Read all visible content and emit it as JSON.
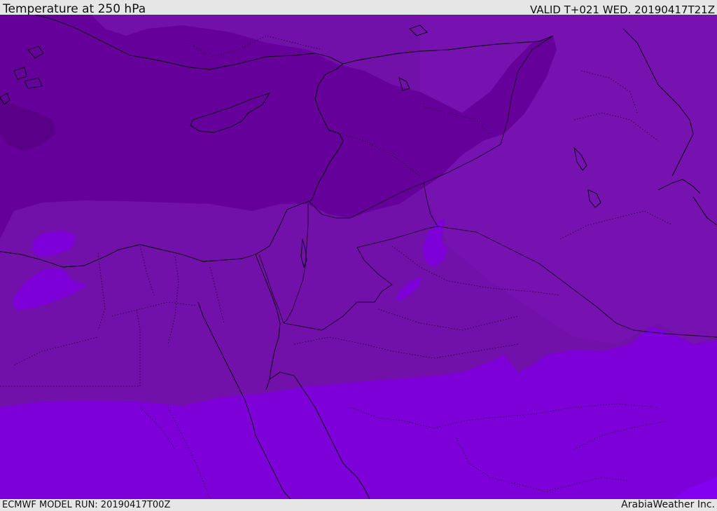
{
  "header": {
    "title": "Temperature at 250 hPa",
    "valid": "VALID T+021 WED. 20190417T21Z"
  },
  "footer": {
    "model_run": "ECMWF MODEL RUN: 20190417T00Z",
    "credit": "ArabiaWeather Inc."
  },
  "colors": {
    "bar_background": "#e6e6e6",
    "band_coldest": "#5a0088",
    "band_cold": "#66009a",
    "band_mid": "#7210aa",
    "band_mid_east": "#7612b0",
    "band_warm": "#7d00d8",
    "band_warmest": "#8400f0",
    "coastline": "#000000",
    "border_line": "#1a0026"
  }
}
